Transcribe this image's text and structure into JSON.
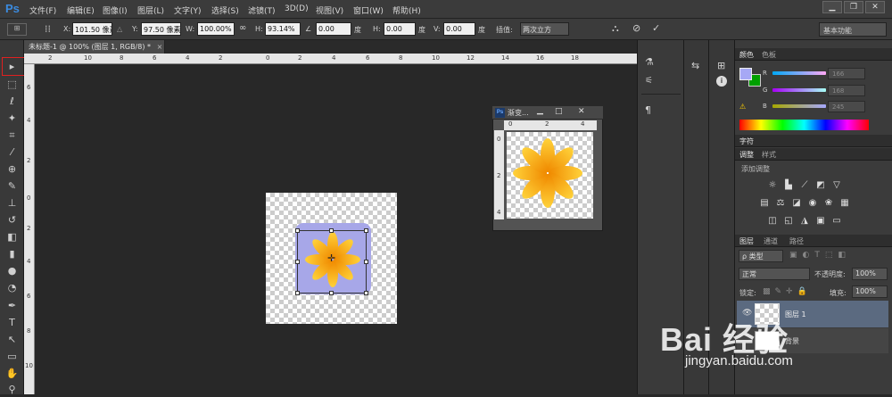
{
  "app": {
    "logo": "Ps"
  },
  "menu": [
    "文件(F)",
    "编辑(E)",
    "图像(I)",
    "图层(L)",
    "文字(Y)",
    "选择(S)",
    "滤镜(T)",
    "3D(D)",
    "视图(V)",
    "窗口(W)",
    "帮助(H)"
  ],
  "window_controls": {
    "minimize": "▁",
    "restore": "❐",
    "close": "✕"
  },
  "options": {
    "x_label": "X:",
    "x_value": "101.50 像素",
    "y_label": "Y:",
    "y_value": "97.50 像素",
    "w_label": "W:",
    "w_value": "100.00%",
    "h_label": "H:",
    "h_value": "93.14%",
    "angle_value": "0.00",
    "angle_unit": "度",
    "hskew_label": "H:",
    "hskew_value": "0.00",
    "hskew_unit": "度",
    "vskew_label": "V:",
    "vskew_value": "0.00",
    "vskew_unit": "度",
    "interp_label": "插值:",
    "interp_value": "两次立方",
    "workspace": "基本功能"
  },
  "document_tab": "未标题-1 @ 100% (图层 1, RGB/8) *",
  "close_x": "×",
  "ruler": {
    "h": [
      "2",
      "10",
      "8",
      "6",
      "4",
      "2",
      "0",
      "2",
      "4",
      "6",
      "8",
      "10",
      "12",
      "14",
      "16",
      "18"
    ],
    "v": [
      "6",
      "4",
      "2",
      "0",
      "2",
      "4",
      "6",
      "8",
      "10"
    ]
  },
  "float_window": {
    "title": "渐变...",
    "ruler_h": [
      "0",
      "2",
      "4"
    ],
    "ruler_v": [
      "0",
      "2",
      "4"
    ]
  },
  "color_panel": {
    "tabs": [
      "颜色",
      "色板"
    ],
    "r_label": "R",
    "r_value": "166",
    "g_label": "G",
    "g_value": "168",
    "b_label": "B",
    "b_value": "245",
    "foreground": "#a6a8f5",
    "background": "#00a000"
  },
  "char_panel": {
    "tab": "字符"
  },
  "adjust_panel": {
    "tabs": [
      "调整",
      "样式"
    ],
    "title": "添加调整"
  },
  "layers_panel": {
    "tabs": [
      "图层",
      "通道",
      "路径"
    ],
    "filter": "ρ 类型",
    "blend": "正常",
    "opacity_label": "不透明度:",
    "opacity": "100%",
    "lock_label": "锁定:",
    "fill_label": "填充:",
    "fill": "100%",
    "layer1": "图层 1",
    "layer2": "背景"
  },
  "watermark": {
    "text": "Bai 经验",
    "url": "jingyan.baidu.com"
  },
  "colors": {
    "accent": "#3b8be0",
    "selection_red": "#e02020",
    "layer_bg": "#a7a7e8",
    "flower": "#f5a000"
  }
}
